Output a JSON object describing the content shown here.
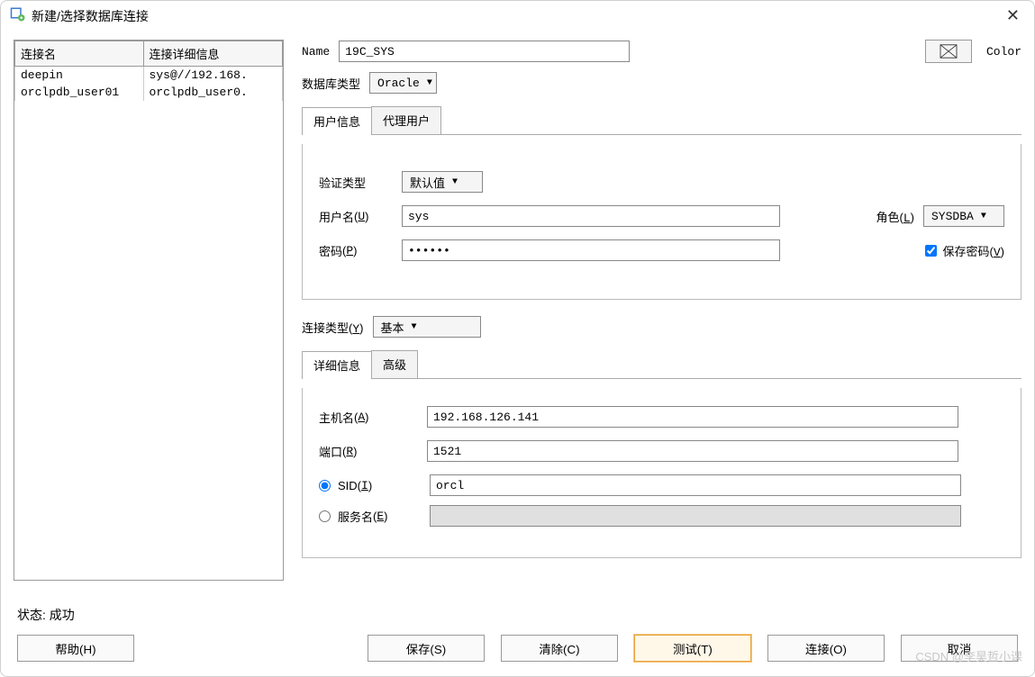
{
  "window": {
    "title": "新建/选择数据库连接"
  },
  "table": {
    "col_name": "连接名",
    "col_detail": "连接详细信息",
    "rows": [
      {
        "name": "deepin",
        "detail": "sys@//192.168."
      },
      {
        "name": "orclpdb_user01",
        "detail": "orclpdb_user0."
      }
    ]
  },
  "form": {
    "name_label": "Name",
    "name_value": "19C_SYS",
    "color_label": "Color",
    "dbtype_label": "数据库类型",
    "dbtype_value": "Oracle",
    "tabs": {
      "user": "用户信息",
      "proxy": "代理用户"
    },
    "auth_label": "验证类型",
    "auth_value": "默认值",
    "username_label": "用户名",
    "username_mn": "U",
    "username_value": "sys",
    "role_label": "角色",
    "role_mn": "L",
    "role_value": "SYSDBA",
    "password_label": "密码",
    "password_mn": "P",
    "password_value": "••••••",
    "savepw_label": "保存密码",
    "savepw_mn": "V",
    "conntype_label": "连接类型",
    "conntype_mn": "Y",
    "conntype_value": "基本",
    "detail_tabs": {
      "detail": "详细信息",
      "adv": "高级"
    },
    "host_label": "主机名",
    "host_mn": "A",
    "host_value": "192.168.126.141",
    "port_label": "端口",
    "port_mn": "R",
    "port_value": "1521",
    "sid_label": "SID",
    "sid_mn": "I",
    "sid_value": "orcl",
    "service_label": "服务名",
    "service_mn": "E",
    "service_value": ""
  },
  "status": {
    "label": "状态:",
    "value": "成功"
  },
  "buttons": {
    "help": "帮助(H)",
    "save": "保存(S)",
    "clear": "清除(C)",
    "test": "测试(T)",
    "connect": "连接(O)",
    "cancel": "取消"
  },
  "watermark": "CSDN @李昊哲小课"
}
